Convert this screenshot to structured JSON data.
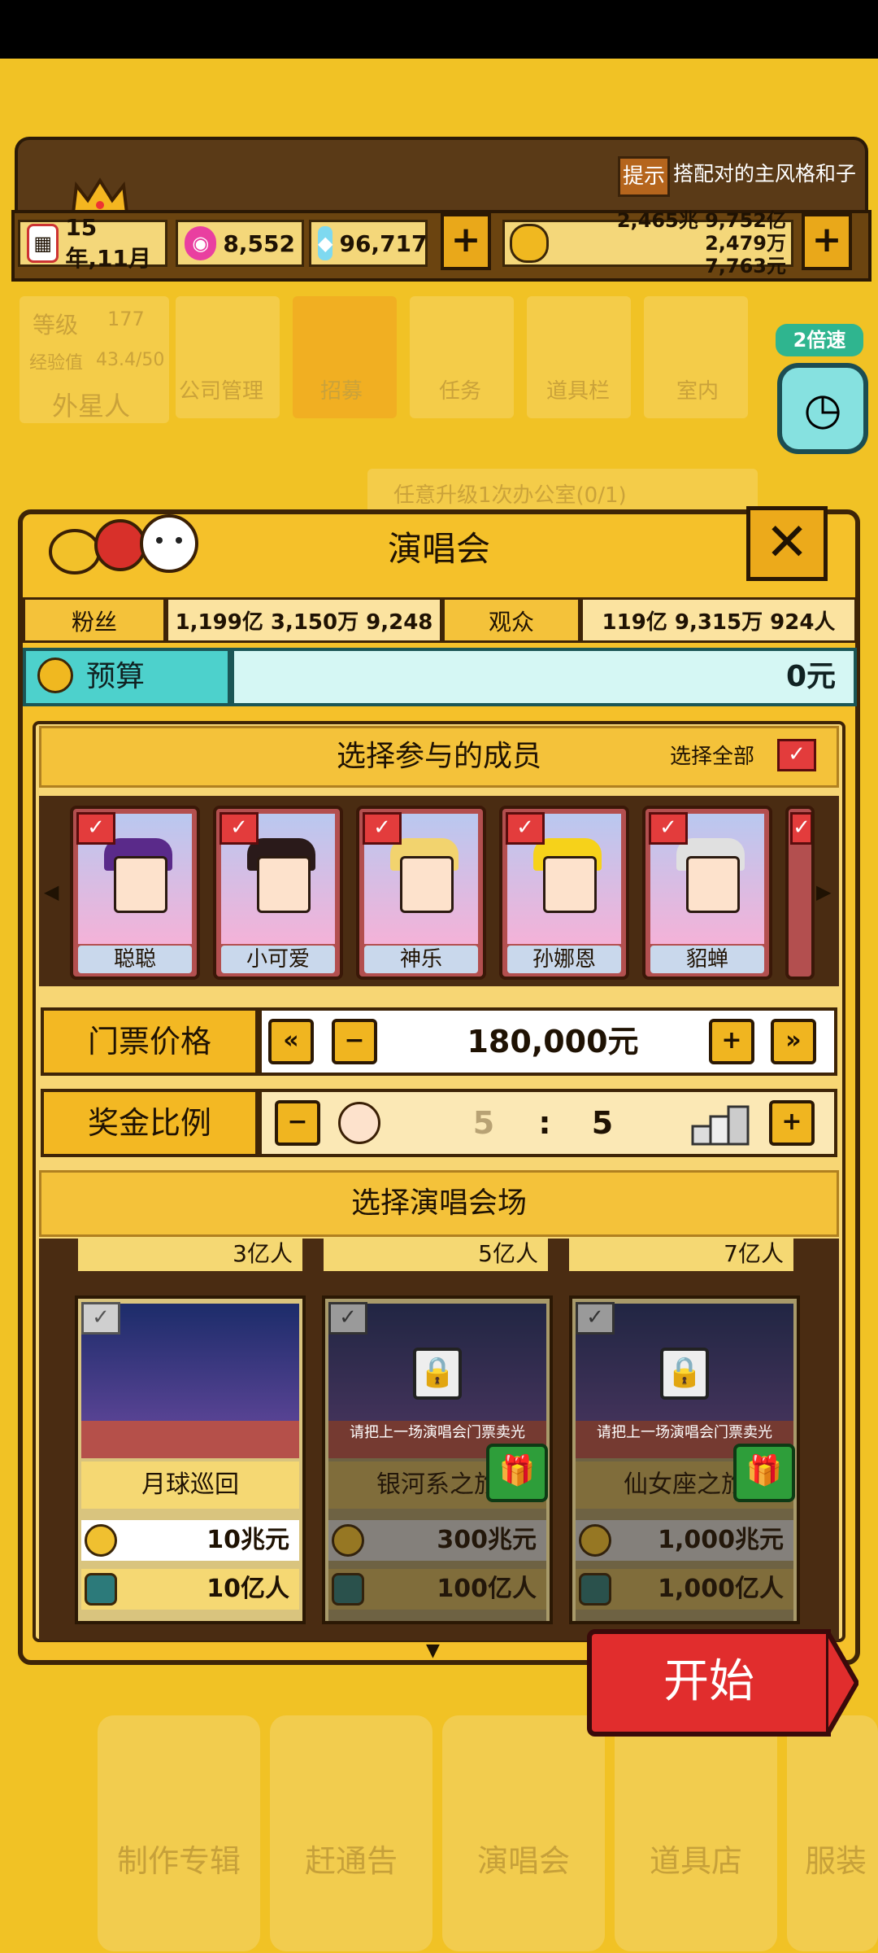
{
  "header": {
    "hint_badge": "提示",
    "hint_text": "搭配对的主风格和子",
    "date": "15年,11月",
    "gems": "8,552",
    "diamonds": "96,717",
    "money_line1": "2,465兆 9,752亿 2,479万",
    "money_line2": "7,763元",
    "plus": "+"
  },
  "background_menu": {
    "level_label": "等级",
    "level_value": "177",
    "exp_label": "经验值",
    "exp_value": "43.4/50",
    "player_type": "外星人",
    "tabs": [
      "公司管理",
      "招募",
      "任务",
      "道具栏",
      "室内"
    ],
    "quest_text": "任意升级1次办公室(0/1)",
    "speed_label": "2倍速"
  },
  "dialog": {
    "title": "演唱会",
    "close": "✕",
    "fans_label": "粉丝",
    "fans_value": "1,199亿 3,150万 9,248人",
    "audience_label": "观众",
    "audience_value": "119亿 9,315万 924人",
    "budget_label": "预算",
    "budget_value": "0元",
    "members_header": "选择参与的成员",
    "select_all": "选择全部",
    "members": [
      {
        "name": "聪聪",
        "hair": "#5a2a8a",
        "checked": true
      },
      {
        "name": "小可爱",
        "hair": "#2a1a1a",
        "checked": true
      },
      {
        "name": "神乐",
        "hair": "#f2d36e",
        "checked": true
      },
      {
        "name": "孙娜恩",
        "hair": "#f6d21a",
        "checked": true
      },
      {
        "name": "貂蝉",
        "hair": "#e0e0e0",
        "checked": true
      }
    ],
    "ticket_label": "门票价格",
    "ticket_value": "180,000元",
    "bonus_label": "奖金比例",
    "bonus_left": "5",
    "bonus_sep": ":",
    "bonus_right": "5",
    "venue_header": "选择演唱会场",
    "venue_top_pops": [
      "3亿人",
      "5亿人",
      "7亿人"
    ],
    "venues": [
      {
        "name": "月球巡回",
        "cost": "10兆元",
        "people": "10亿人",
        "locked": false
      },
      {
        "name": "银河系之旅",
        "cost": "300兆元",
        "people": "100亿人",
        "locked": true
      },
      {
        "name": "仙女座之旅",
        "cost": "1,000兆元",
        "people": "1,000亿人",
        "locked": true
      }
    ],
    "lock_note": "请把上一场演唱会门票卖光",
    "start": "开始"
  },
  "bottom_nav": [
    "制作专辑",
    "赶通告",
    "演唱会",
    "道具店",
    "服装"
  ]
}
